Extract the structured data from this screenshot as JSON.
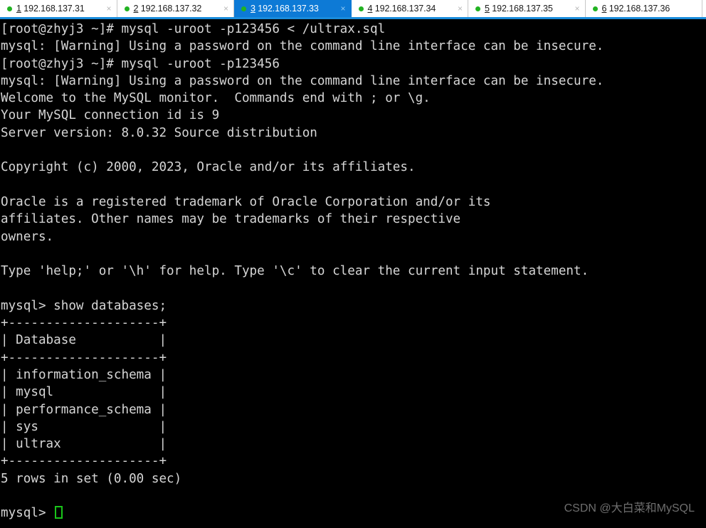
{
  "tabbar": {
    "accent_color": "#0d7ad6",
    "underline_color": "#1a8cdb",
    "status_dot_color": "#22b322",
    "close_icon": "×",
    "tabs": [
      {
        "index": "1",
        "host": "192.168.137.31",
        "active": false
      },
      {
        "index": "2",
        "host": "192.168.137.32",
        "active": false
      },
      {
        "index": "3",
        "host": "192.168.137.33",
        "active": true
      },
      {
        "index": "4",
        "host": "192.168.137.34",
        "active": false
      },
      {
        "index": "5",
        "host": "192.168.137.35",
        "active": false
      },
      {
        "index": "6",
        "host": "192.168.137.36",
        "active": false
      }
    ]
  },
  "terminal": {
    "background_color": "#000000",
    "text_color": "#d6d6d6",
    "cursor_color": "#19c419",
    "prompt_shell": "[root@zhyj3 ~]#",
    "prompt_mysql": "mysql>",
    "lines": [
      "[root@zhyj3 ~]# mysql -uroot -p123456 < /ultrax.sql",
      "mysql: [Warning] Using a password on the command line interface can be insecure.",
      "[root@zhyj3 ~]# mysql -uroot -p123456",
      "mysql: [Warning] Using a password on the command line interface can be insecure.",
      "Welcome to the MySQL monitor.  Commands end with ; or \\g.",
      "Your MySQL connection id is 9",
      "Server version: 8.0.32 Source distribution",
      "",
      "Copyright (c) 2000, 2023, Oracle and/or its affiliates.",
      "",
      "Oracle is a registered trademark of Oracle Corporation and/or its",
      "affiliates. Other names may be trademarks of their respective",
      "owners.",
      "",
      "Type 'help;' or '\\h' for help. Type '\\c' to clear the current input statement.",
      "",
      "mysql> show databases;",
      "+--------------------+",
      "| Database           |",
      "+--------------------+",
      "| information_schema |",
      "| mysql              |",
      "| performance_schema |",
      "| sys                |",
      "| ultrax             |",
      "+--------------------+",
      "5 rows in set (0.00 sec)",
      ""
    ],
    "final_prompt": "mysql> ",
    "query_result": {
      "column_header": "Database",
      "rows": [
        "information_schema",
        "mysql",
        "performance_schema",
        "sys",
        "ultrax"
      ],
      "row_count_text": "5 rows in set (0.00 sec)"
    },
    "session_info": {
      "connection_id": "9",
      "server_version": "8.0.32 Source distribution",
      "copyright": "Copyright (c) 2000, 2023, Oracle and/or its affiliates."
    }
  },
  "watermark": {
    "text": "CSDN @大白菜和MySQL"
  }
}
